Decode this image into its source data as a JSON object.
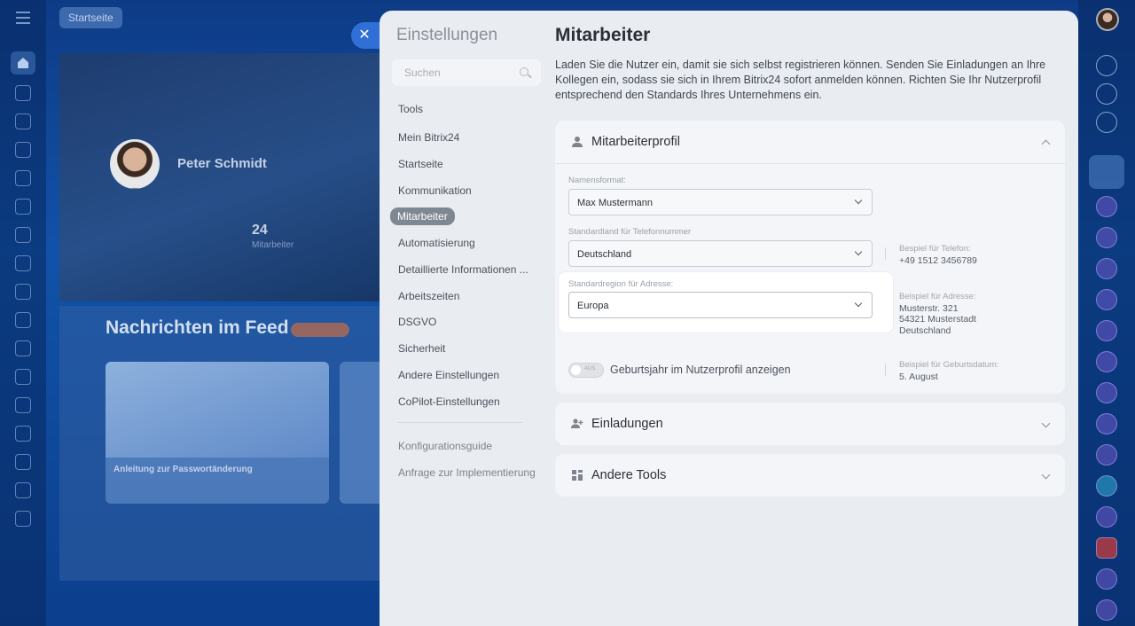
{
  "background": {
    "breadcrumb": "Startseite",
    "profile_name": "Peter Schmidt",
    "employee_count": "24",
    "employee_count_label": "Mitarbeiter",
    "feed_title": "Nachrichten im Feed",
    "feed_card_title": "Anleitung zur Passwortänderung"
  },
  "nav": {
    "title": "Einstellungen",
    "search_placeholder": "Suchen",
    "items": [
      {
        "label": "Tools"
      },
      {
        "label": "Mein Bitrix24"
      },
      {
        "label": "Startseite"
      },
      {
        "label": "Kommunikation"
      },
      {
        "label": "Mitarbeiter",
        "active": true
      },
      {
        "label": "Automatisierung"
      },
      {
        "label": "Detaillierte Informationen ..."
      },
      {
        "label": "Arbeitszeiten"
      },
      {
        "label": "DSGVO"
      },
      {
        "label": "Sicherheit"
      },
      {
        "label": "Andere Einstellungen"
      },
      {
        "label": "CoPilot-Einstellungen"
      }
    ],
    "footer_items": [
      {
        "label": "Konfigurationsguide"
      },
      {
        "label": "Anfrage zur Implementierung"
      }
    ]
  },
  "main": {
    "title": "Mitarbeiter",
    "description": "Laden Sie die Nutzer ein, damit sie sich selbst registrieren können. Senden Sie Einladungen an Ihre Kollegen ein, sodass sie sich in Ihrem Bitrix24 sofort anmelden können. Richten Sie Ihr Nutzerprofil entsprechend den Standards Ihres Unternehmens ein.",
    "profile_section": {
      "title": "Mitarbeiterprofil",
      "name_format_label": "Namensformat:",
      "name_format_value": "Max Mustermann",
      "phone_country_label": "Standardland für Telefonnummer",
      "phone_country_value": "Deutschland",
      "phone_example_label": "Bespiel für Telefon:",
      "phone_example_value": "+49 1512 3456789",
      "address_region_label": "Standardregion für Adresse:",
      "address_region_value": "Europa",
      "address_example_label": "Beispiel für Adresse:",
      "address_example_lines": [
        "Musterstr. 321",
        "54321 Musterstadt",
        "Deutschland"
      ],
      "birth_toggle_state": "AUS",
      "birth_toggle_label": "Geburtsjahr im Nutzerprofil anzeigen",
      "birth_example_label": "Beispiel für Geburtsdatum:",
      "birth_example_value": "5. August"
    },
    "invitations_section": {
      "title": "Einladungen"
    },
    "other_tools_section": {
      "title": "Andere Tools"
    }
  },
  "colors": {
    "panel_bg": "#e9edf2",
    "accent_blue": "#2f6fd6",
    "active_nav_bg": "#7e8892"
  },
  "icons": {
    "close": "close-icon",
    "search": "search-icon",
    "profile": "user-icon",
    "invite": "add-user-icon",
    "tools": "grid-icon"
  }
}
